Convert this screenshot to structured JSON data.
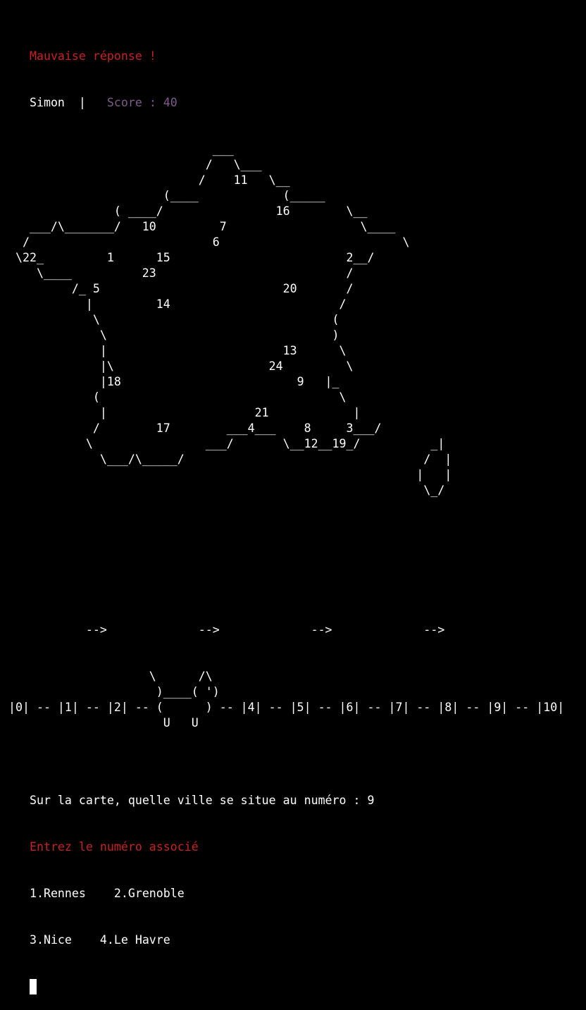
{
  "status": {
    "result_message": "Mauvaise réponse !",
    "player_name": "Simon",
    "separator": "  |   ",
    "score_label": "Score : 40"
  },
  "map": {
    "lines": [
      "                              ___",
      "                             /   \\___",
      "                            /    11   \\__",
      "                       (____            (_____",
      "                ( ____/                16        \\__",
      "    ___/\\_______/   10         7                   \\____",
      "   /                          6                          \\",
      "  \\22_         1      15                         2__/",
      "     \\____          23                           /",
      "          /_ 5                          20       /",
      "            |         14                        /",
      "             \\                                 (",
      "              \\                                )",
      "              |                         13      \\",
      "              |\\                      24         \\",
      "              |18                         9   |_",
      "             (                                  \\",
      "              |                     21            |",
      "             /        17        ___4___    8     3___/",
      "            \\                ___/       \\__12__19_/          _|",
      "              \\___/\\_____/                                  /  |",
      "                                                           |   |",
      "                                                            \\_/"
    ]
  },
  "slide": {
    "lines": [
      "",
      "",
      "",
      "",
      "",
      "            -->             -->             -->             -->",
      "",
      "",
      "                     \\      /\\",
      "                      )____( ')",
      " |0| -- |1| -- |2| -- (      ) -- |4| -- |5| -- |6| -- |7| -- |8| -- |9| -- |10|",
      "                       U   U"
    ]
  },
  "question": {
    "text": "Sur la carte, quelle ville se situe au numéro : 9",
    "prompt": "Entrez le numéro associé"
  },
  "options": {
    "row1": "1.Rennes    2.Grenoble",
    "row2": "3.Nice    4.Le Havre"
  },
  "colors": {
    "background": "#000000",
    "text": "#ffffff",
    "error": "#cc1f1f",
    "score": "#7d5a8c"
  }
}
